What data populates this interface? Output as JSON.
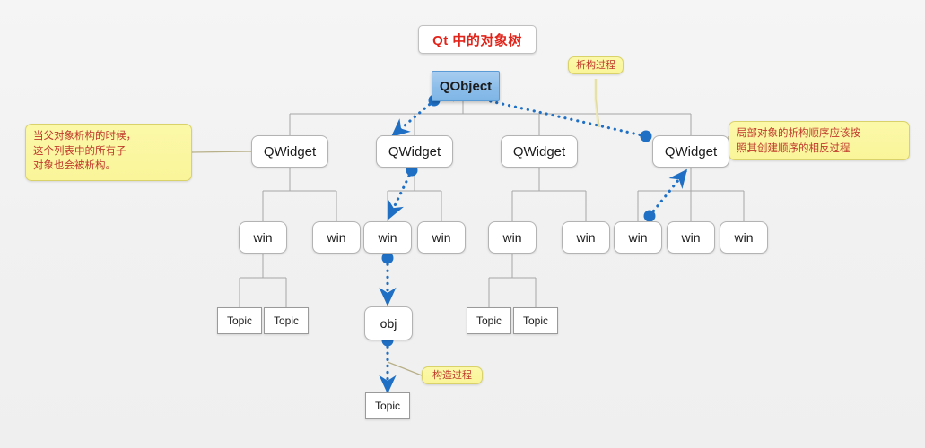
{
  "page": {
    "background": "#f2f2f2",
    "title_color": "#e2231a",
    "line_color": "#a6a6a6",
    "arrow_color": "#1f6fc4",
    "node_border": "#b3b3b3",
    "root_fill": "#8cbde9",
    "callout_fill": "#faf59a"
  },
  "title": {
    "text": "Qt 中的对象树"
  },
  "tree": {
    "root": {
      "label": "QObject"
    },
    "widgets": [
      {
        "label": "QWidget"
      },
      {
        "label": "QWidget"
      },
      {
        "label": "QWidget"
      },
      {
        "label": "QWidget"
      }
    ],
    "wins": [
      {
        "label": "win"
      },
      {
        "label": "win"
      },
      {
        "label": "win"
      },
      {
        "label": "win"
      },
      {
        "label": "win"
      },
      {
        "label": "win"
      },
      {
        "label": "win"
      },
      {
        "label": "win"
      }
    ],
    "topics": [
      {
        "label": "Topic"
      },
      {
        "label": "Topic"
      },
      {
        "label": "Topic"
      },
      {
        "label": "Topic"
      }
    ],
    "obj": {
      "label": "obj"
    },
    "obj_topic": {
      "label": "Topic"
    }
  },
  "callouts": {
    "left": {
      "line1": "当父对象析构的时候，",
      "line2": "这个列表中的所有子",
      "line3": "对象也会被析构。"
    },
    "right": {
      "line1": "局部对象的析构顺序应该按",
      "line2": "照其创建顺序的相反过程"
    },
    "destruct": {
      "text": "析构过程"
    },
    "construct": {
      "text": "构造过程"
    }
  }
}
